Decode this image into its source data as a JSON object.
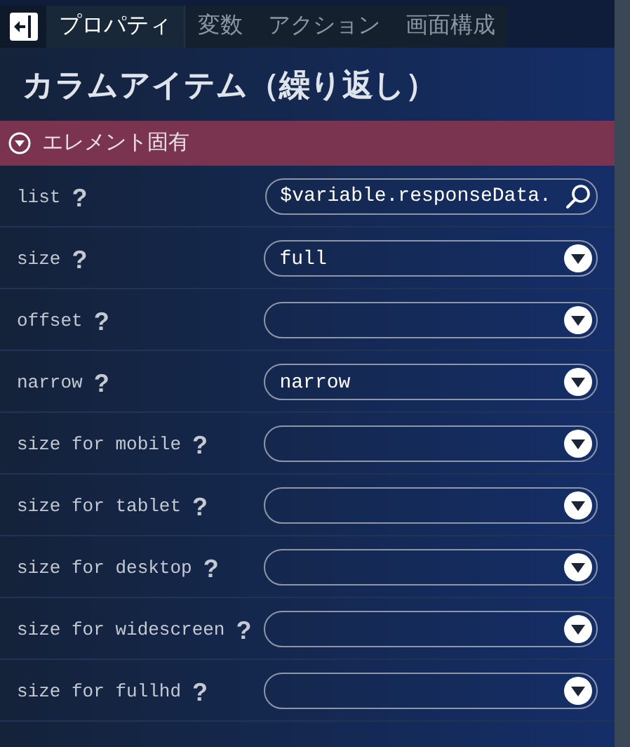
{
  "tabs": [
    {
      "label": "プロパティ",
      "selected": true
    },
    {
      "label": "変数",
      "selected": false
    },
    {
      "label": "アクション",
      "selected": false
    },
    {
      "label": "画面構成",
      "selected": false
    }
  ],
  "title": "カラムアイテム（繰り返し）",
  "section": {
    "label": "エレメント固有",
    "expanded": true
  },
  "fields": [
    {
      "label": "list",
      "help": "?",
      "kind": "search",
      "value": "$variable.responseData."
    },
    {
      "label": "size",
      "help": "?",
      "kind": "select",
      "value": "full"
    },
    {
      "label": "offset",
      "help": "?",
      "kind": "select"
    },
    {
      "label": "narrow",
      "help": "?",
      "kind": "select",
      "value": "narrow"
    },
    {
      "label": "size for mobile",
      "help": "?",
      "kind": "select"
    },
    {
      "label": "size for tablet",
      "help": "?",
      "kind": "select"
    },
    {
      "label": "size for desktop",
      "help": "?",
      "kind": "select"
    },
    {
      "label": "size for widescreen",
      "help": "?",
      "kind": "select"
    },
    {
      "label": "size for fullhd",
      "help": "?",
      "kind": "select"
    }
  ]
}
